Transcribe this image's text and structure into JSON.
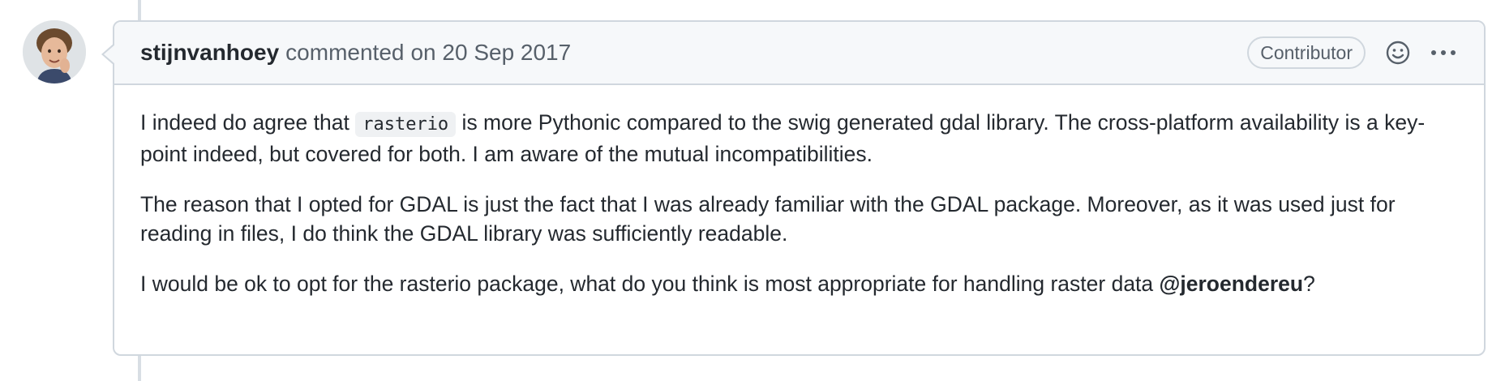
{
  "comment": {
    "author": "stijnvanhoey",
    "action": "commented",
    "timestamp": "on 20 Sep 2017",
    "role_badge": "Contributor",
    "icons": {
      "reaction": "smiley-icon",
      "more": "kebab-horizontal-icon"
    },
    "body": {
      "p1": {
        "before_code": "I indeed do agree that ",
        "code": "rasterio",
        "after_code": " is more Pythonic compared to the swig generated gdal library. The cross-platform availability is a key-point indeed, but covered for both. I am aware of the mutual incompatibilities."
      },
      "p2": "The reason that I opted for GDAL is just the fact that I was already familiar with the GDAL package. Moreover, as it was used just for reading in files, I do think the GDAL library was sufficiently readable.",
      "p3": {
        "before_mention": "I would be ok to opt for the rasterio package, what do you think is most appropriate for handling raster data ",
        "mention": "@jeroendereu",
        "after_mention": "?"
      }
    }
  },
  "colors": {
    "border": "#d0d7de",
    "header_bg": "#f6f8fa",
    "text": "#24292f",
    "muted": "#57606a"
  }
}
